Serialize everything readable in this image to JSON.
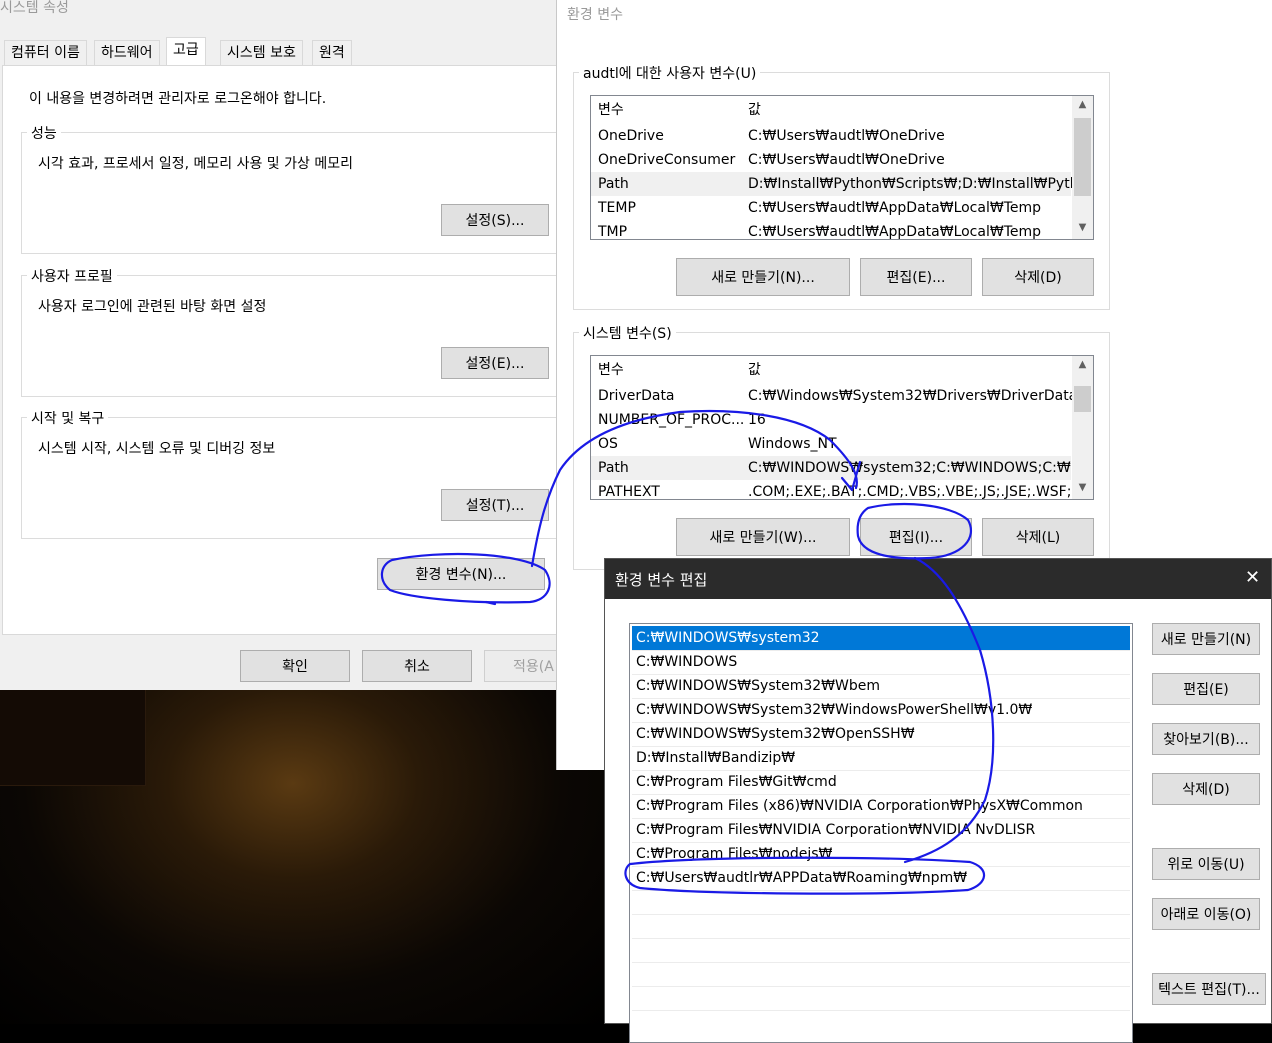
{
  "sysprops": {
    "title": "시스템 속성",
    "tabs": [
      "컴퓨터 이름",
      "하드웨어",
      "고급",
      "시스템 보호",
      "원격"
    ],
    "notice": "이 내용을 변경하려면 관리자로 로그온해야 합니다.",
    "performance": {
      "title": "성능",
      "desc": "시각 효과, 프로세서 일정, 메모리 사용 및 가상 메모리",
      "button": "설정(S)..."
    },
    "profile": {
      "title": "사용자 프로필",
      "desc": "사용자 로그인에 관련된 바탕 화면 설정",
      "button": "설정(E)..."
    },
    "startup": {
      "title": "시작 및 복구",
      "desc": "시스템 시작, 시스템 오류 및 디버깅 정보",
      "button": "설정(T)..."
    },
    "env_button": "환경 변수(N)...",
    "ok": "확인",
    "cancel": "취소",
    "apply": "적용(A"
  },
  "envvars": {
    "title": "환경 변수",
    "user_group": "audtl에 대한 사용자 변수(U)",
    "col_var": "변수",
    "col_val": "값",
    "user_vars": [
      {
        "name": "OneDrive",
        "value": "C:₩Users₩audtl₩OneDrive"
      },
      {
        "name": "OneDriveConsumer",
        "value": "C:₩Users₩audtl₩OneDrive"
      },
      {
        "name": "Path",
        "value": "D:₩Install₩Python₩Scripts₩;D:₩Install₩Pytho..."
      },
      {
        "name": "TEMP",
        "value": "C:₩Users₩audtl₩AppData₩Local₩Temp"
      },
      {
        "name": "TMP",
        "value": "C:₩Users₩audtl₩AppData₩Local₩Temp"
      }
    ],
    "user_buttons": {
      "new": "새로 만들기(N)...",
      "edit": "편집(E)...",
      "delete": "삭제(D)"
    },
    "system_group": "시스템 변수(S)",
    "system_vars": [
      {
        "name": "DriverData",
        "value": "C:₩Windows₩System32₩Drivers₩DriverData"
      },
      {
        "name": "NUMBER_OF_PROC...",
        "value": "16"
      },
      {
        "name": "OS",
        "value": "Windows_NT"
      },
      {
        "name": "Path",
        "value": "C:₩WINDOWS₩system32;C:₩WINDOWS;C:₩..."
      },
      {
        "name": "PATHEXT",
        "value": ".COM;.EXE;.BAT;.CMD;.VBS;.VBE;.JS;.JSE;.WSF;..."
      }
    ],
    "system_buttons": {
      "new": "새로 만들기(W)...",
      "edit": "편집(I)...",
      "delete": "삭제(L)"
    }
  },
  "editdialog": {
    "title": "환경 변수 편집",
    "close_glyph": "✕",
    "entries": [
      "C:₩WINDOWS₩system32",
      "C:₩WINDOWS",
      "C:₩WINDOWS₩System32₩Wbem",
      "C:₩WINDOWS₩System32₩WindowsPowerShell₩v1.0₩",
      "C:₩WINDOWS₩System32₩OpenSSH₩",
      "D:₩Install₩Bandizip₩",
      "C:₩Program Files₩Git₩cmd",
      "C:₩Program Files (x86)₩NVIDIA Corporation₩PhysX₩Common",
      "C:₩Program Files₩NVIDIA Corporation₩NVIDIA NvDLISR",
      "C:₩Program Files₩nodejs₩",
      "C:₩Users₩audtlr₩APPData₩Roaming₩npm₩"
    ],
    "buttons": {
      "new": "새로 만들기(N)",
      "edit": "편집(E)",
      "browse": "찾아보기(B)...",
      "delete": "삭제(D)",
      "up": "위로 이동(U)",
      "down": "아래로 이동(O)",
      "text_edit": "텍스트 편집(T)..."
    }
  },
  "colors": {
    "annotation": "#1a1ae6",
    "selection": "#0078d7",
    "titlebar_dark": "#2b2b2b"
  }
}
